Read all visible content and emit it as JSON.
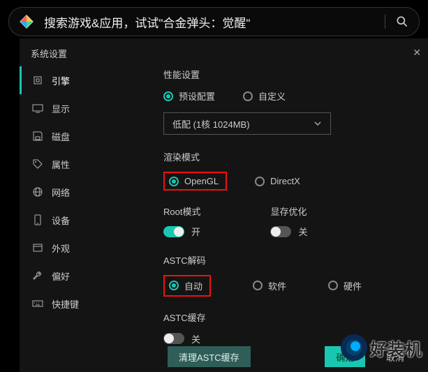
{
  "search": {
    "placeholder": "搜索游戏&应用，试试\"合金弹头：觉醒\""
  },
  "panel": {
    "title": "系统设置"
  },
  "sidebar": {
    "items": [
      {
        "label": "引擎"
      },
      {
        "label": "显示"
      },
      {
        "label": "磁盘"
      },
      {
        "label": "属性"
      },
      {
        "label": "网络"
      },
      {
        "label": "设备"
      },
      {
        "label": "外观"
      },
      {
        "label": "偏好"
      },
      {
        "label": "快捷键"
      }
    ]
  },
  "perf": {
    "title": "性能设置",
    "preset": "预设配置",
    "custom": "自定义",
    "select": "低配 (1核 1024MB)"
  },
  "render": {
    "title": "渲染模式",
    "opengl": "OpenGL",
    "directx": "DirectX"
  },
  "root": {
    "title": "Root模式",
    "on": "开"
  },
  "vram": {
    "title": "显存优化",
    "off": "关"
  },
  "astc": {
    "title": "ASTC解码",
    "auto": "自动",
    "soft": "软件",
    "hard": "硬件"
  },
  "astcc": {
    "title": "ASTC缓存",
    "off": "关"
  },
  "footer": {
    "clear": "清理ASTC缓存",
    "ok": "确定",
    "cancel": "取消"
  },
  "watermark": "好装机"
}
